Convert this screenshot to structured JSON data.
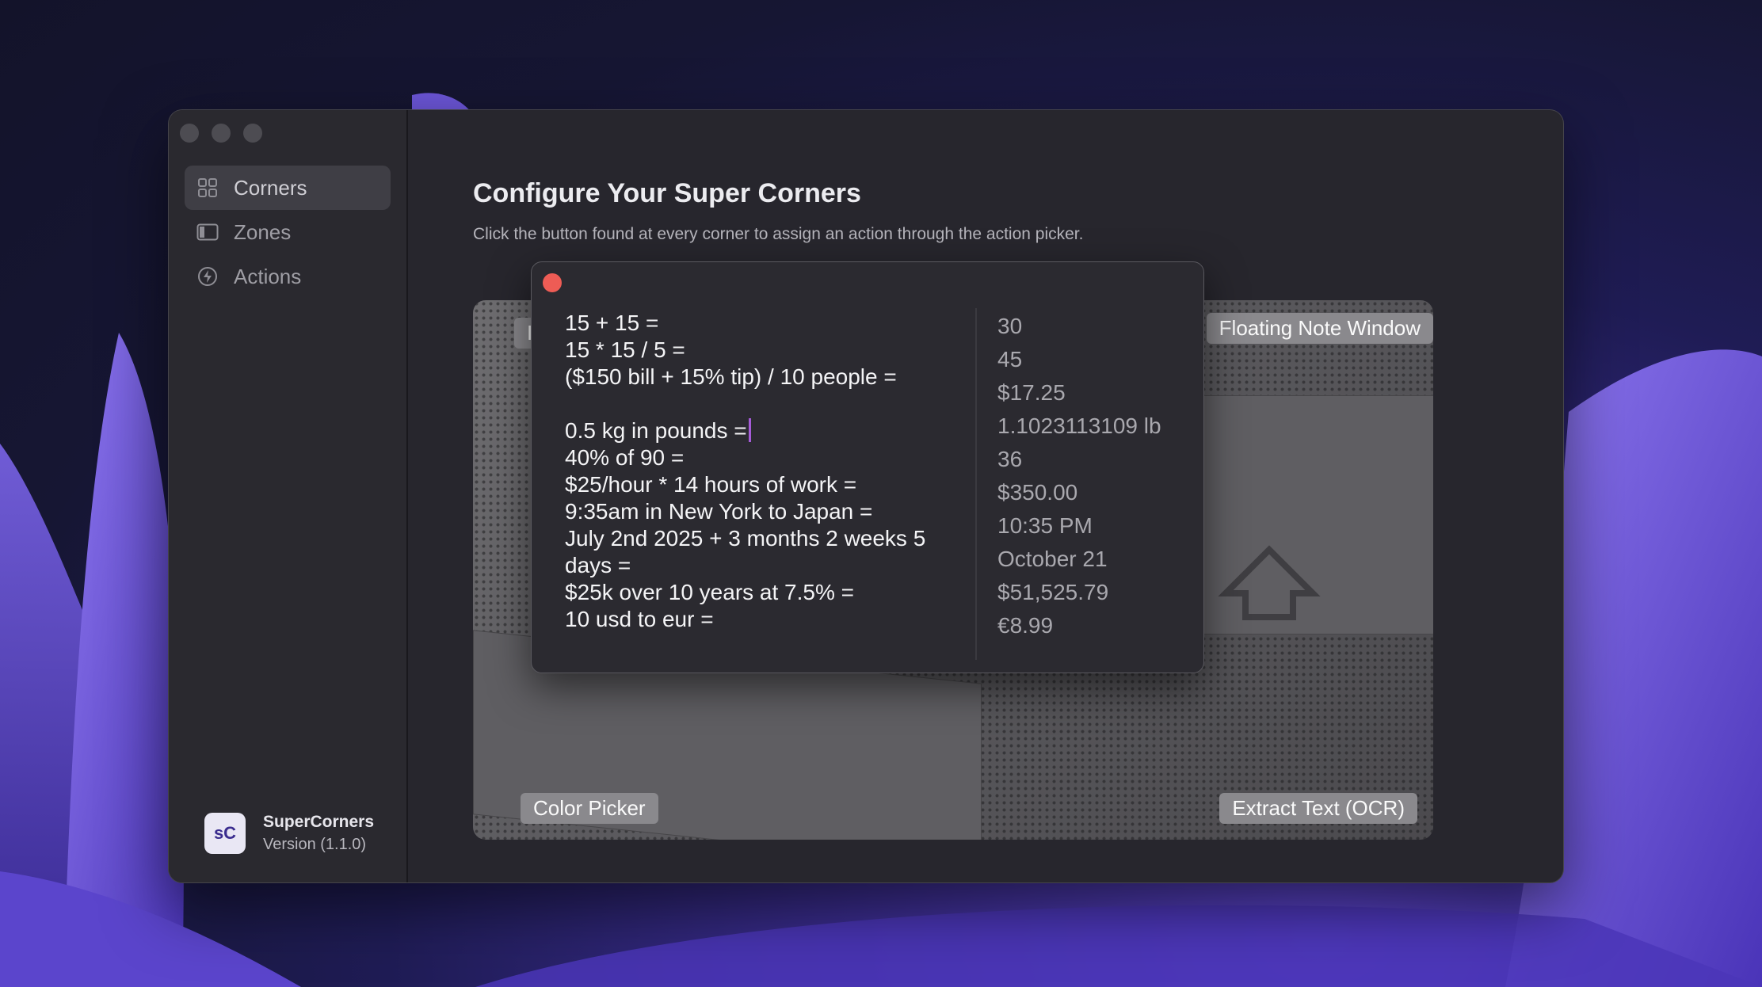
{
  "sidebar": {
    "items": [
      {
        "label": "Corners",
        "icon": "grid-icon",
        "active": true
      },
      {
        "label": "Zones",
        "icon": "sidebar-panel-icon",
        "active": false
      },
      {
        "label": "Actions",
        "icon": "bolt-icon",
        "active": false
      }
    ],
    "app": {
      "logo": "sC",
      "name": "SuperCorners",
      "version": "Version (1.1.0)"
    }
  },
  "main": {
    "title": "Configure Your Super Corners",
    "subtitle": "Click the button found at every corner to assign an action through the action picker."
  },
  "corners": {
    "top_left": "I",
    "top_right": "Floating Note Window",
    "bottom_left": "Color Picker",
    "bottom_right": "Extract Text (OCR)"
  },
  "note": {
    "expressions": [
      "15 + 15 =",
      "15 * 15 / 5 =",
      "($150 bill + 15% tip) / 10 people =",
      "",
      "0.5 kg in pounds =",
      "40% of 90 =",
      "$25/hour * 14 hours of work =",
      "9:35am in New York to Japan =",
      "July 2nd 2025 + 3 months 2 weeks 5",
      "days =",
      "$25k over 10 years at 7.5% =",
      "10 usd to eur ="
    ],
    "results": [
      "30",
      "45",
      "$17.25",
      "1.1023113109 lb",
      "36",
      "$350.00",
      "10:35 PM",
      "October 21",
      "$51,525.79",
      "€8.99"
    ]
  },
  "colors": {
    "close": "#ee5c55",
    "caret": "#a55bd8",
    "accent": "#5a43c8"
  }
}
